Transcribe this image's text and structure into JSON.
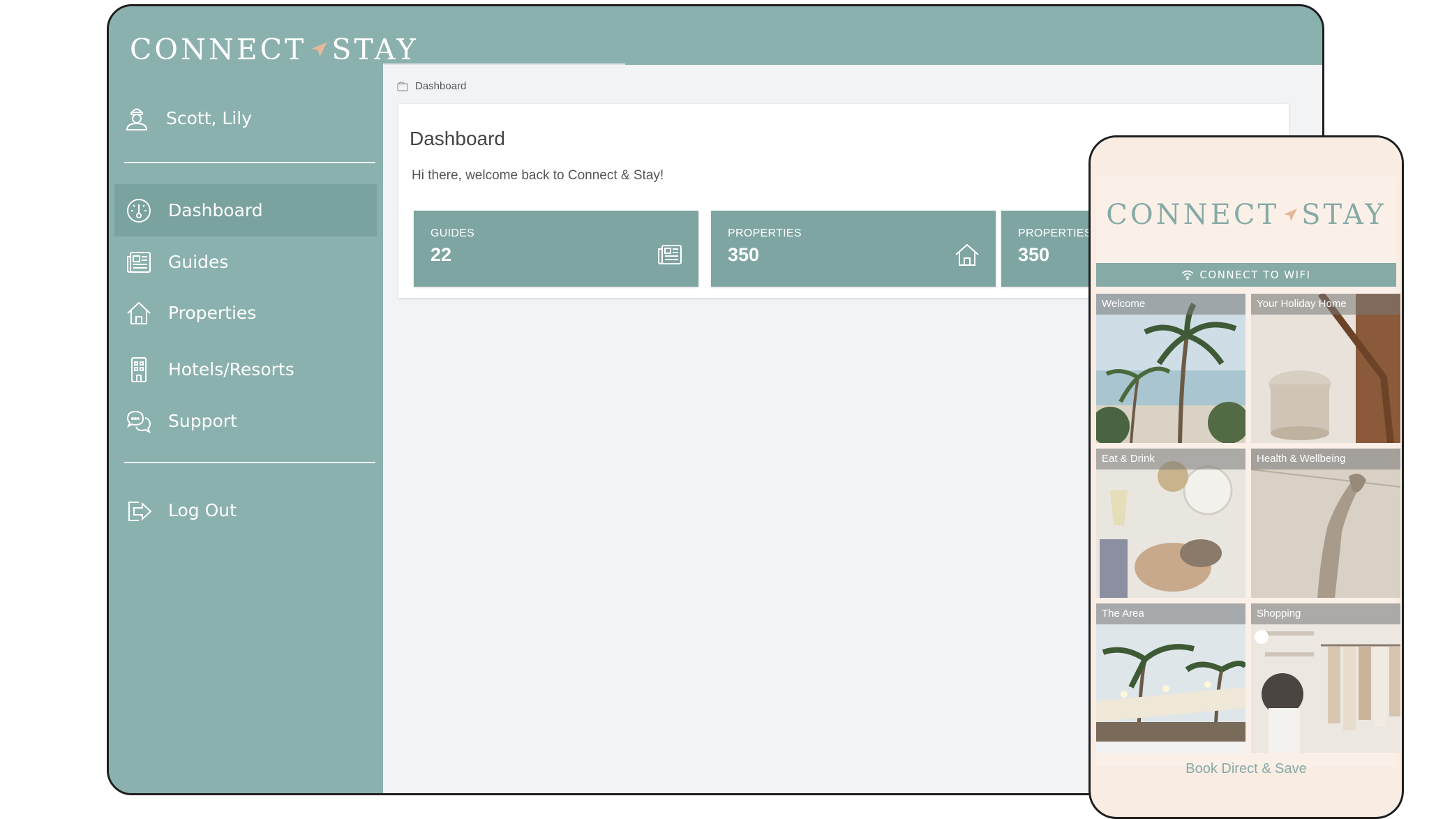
{
  "brand": {
    "left": "CONNECT",
    "right": "STAY"
  },
  "colors": {
    "sidebar": "#8bb1ae",
    "accent": "#7ea5a2",
    "brand_arrow": "#e6b89b",
    "phone_bg": "#fbf0e8"
  },
  "sidebar": {
    "user": {
      "name": "Scott, Lily",
      "icon": "user-icon"
    },
    "items": [
      {
        "label": "Dashboard",
        "icon": "dashboard-icon",
        "active": true
      },
      {
        "label": "Guides",
        "icon": "guides-icon"
      },
      {
        "label": "Properties",
        "icon": "home-icon"
      },
      {
        "label": "Hotels/Resorts",
        "icon": "building-icon"
      },
      {
        "label": "Support",
        "icon": "chat-icon"
      }
    ],
    "logout": {
      "label": "Log Out",
      "icon": "logout-icon"
    }
  },
  "breadcrumb": {
    "label": "Dashboard"
  },
  "dashboard": {
    "title": "Dashboard",
    "welcome": "Hi there, welcome back to Connect & Stay!",
    "stats": [
      {
        "label": "GUIDES",
        "value": "22",
        "icon": "newspaper-icon"
      },
      {
        "label": "PROPERTIES",
        "value": "350",
        "icon": "home-icon"
      },
      {
        "label": "PROPERTIES",
        "value": "350"
      }
    ]
  },
  "phone": {
    "wifi_label": "CONNECT TO WIFI",
    "tiles": [
      {
        "label": "Welcome"
      },
      {
        "label": "Your Holiday Home"
      },
      {
        "label": "Eat & Drink"
      },
      {
        "label": "Health & Wellbeing"
      },
      {
        "label": "The Area"
      },
      {
        "label": "Shopping"
      }
    ],
    "book": "Book Direct & Save"
  }
}
